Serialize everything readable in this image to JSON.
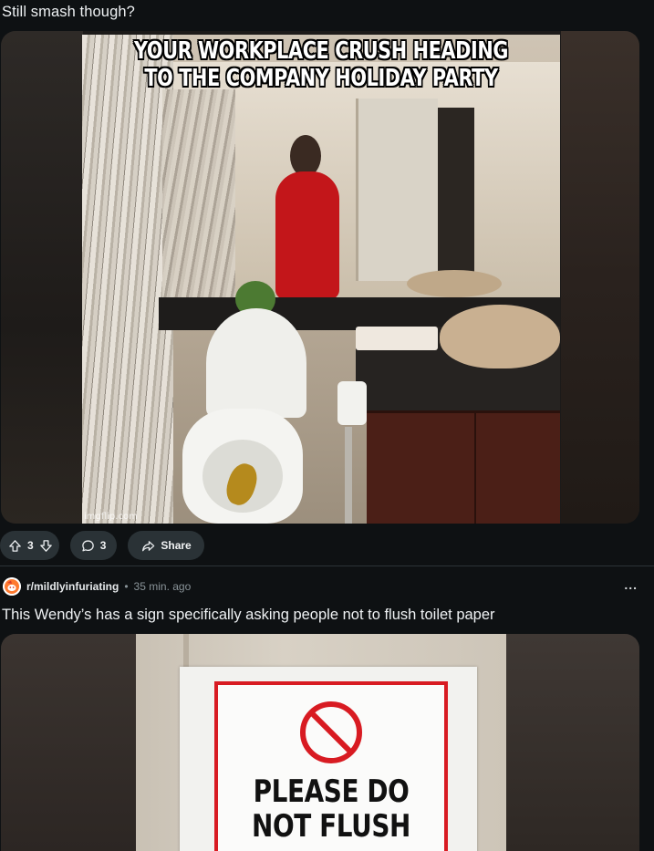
{
  "post1": {
    "title": "Still smash though?",
    "meme": {
      "caption_line1": "YOUR WORKPLACE CRUSH HEADING",
      "caption_line2": "TO THE COMPANY HOLIDAY PARTY",
      "watermark": "imgflip.com"
    },
    "actions": {
      "upvote_count": "3",
      "comment_count": "3",
      "share_label": "Share"
    }
  },
  "post2": {
    "subreddit": "r/mildlyinfuriating",
    "separator": "•",
    "time": "35 min. ago",
    "more_label": "...",
    "title": "This Wendy’s has a sign specifically asking people not to flush toilet paper",
    "sign": {
      "line1": "PLEASE DO",
      "line2": "NOT FLUSH",
      "accent": "#d81b22"
    }
  },
  "colors": {
    "background": "#0e1113",
    "pill": "#2a3236",
    "text": "#eef1f3",
    "muted": "#8a9499"
  }
}
